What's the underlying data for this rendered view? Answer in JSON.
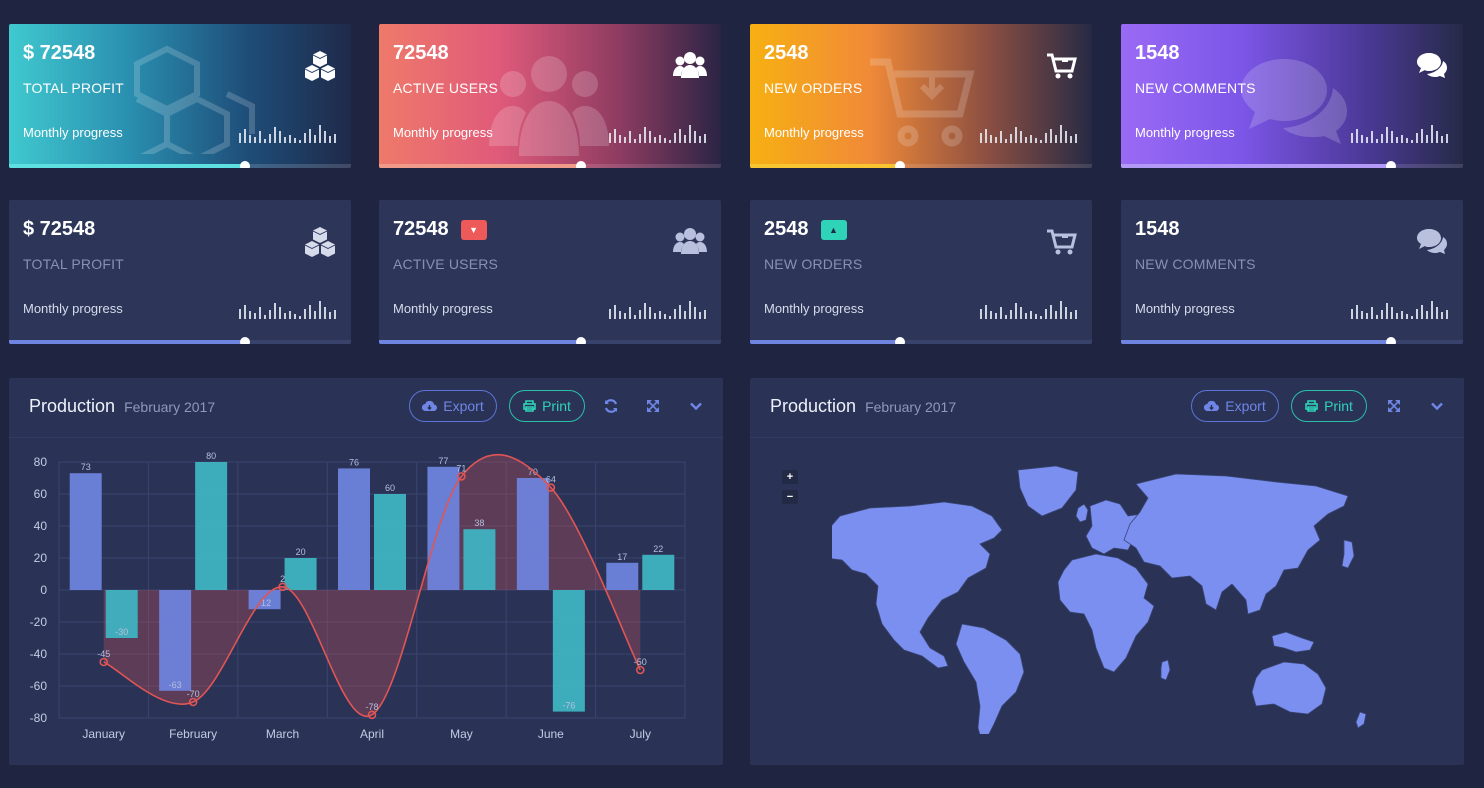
{
  "colors": {
    "page_bg": "#1f2540",
    "flat_card": "#2d3658",
    "panel": "#2a3356",
    "blue_bar": "#6f84e0",
    "teal_bar": "#3fb7c4",
    "red_line": "#e05555",
    "export": "#5b73d6",
    "print": "#2bbfa8"
  },
  "gradient_cards": [
    {
      "value": "$ 72548",
      "label": "TOTAL PROFIT",
      "progress_label": "Monthly progress",
      "icon": "cubes-icon",
      "progress": 0.69
    },
    {
      "value": "72548",
      "label": "ACTIVE USERS",
      "progress_label": "Monthly progress",
      "icon": "users-icon",
      "progress": 0.59
    },
    {
      "value": "2548",
      "label": "NEW ORDERS",
      "progress_label": "Monthly progress",
      "icon": "cart-icon",
      "progress": 0.44
    },
    {
      "value": "1548",
      "label": "NEW COMMENTS",
      "progress_label": "Monthly progress",
      "icon": "comments-icon",
      "progress": 0.79
    }
  ],
  "flat_cards": [
    {
      "value": "$ 72548",
      "label": "TOTAL PROFIT",
      "progress_label": "Monthly progress",
      "icon": "cubes-icon",
      "progress": 0.69
    },
    {
      "value": "72548",
      "label": "ACTIVE USERS",
      "progress_label": "Monthly progress",
      "icon": "users-icon",
      "badge": "down-caret-icon",
      "progress": 0.59
    },
    {
      "value": "2548",
      "label": "NEW ORDERS",
      "progress_label": "Monthly progress",
      "icon": "cart-icon",
      "badge": "up-caret-icon",
      "progress": 0.44
    },
    {
      "value": "1548",
      "label": "NEW COMMENTS",
      "progress_label": "Monthly progress",
      "icon": "comments-icon",
      "progress": 0.79
    }
  ],
  "panels": [
    {
      "title": "Production",
      "subtitle": "February 2017",
      "export_label": "Export",
      "print_label": "Print"
    },
    {
      "title": "Production",
      "subtitle": "February 2017",
      "export_label": "Export",
      "print_label": "Print"
    }
  ],
  "map": {
    "zoom_in": "+",
    "zoom_out": "−"
  },
  "chart_data": {
    "type": "bar",
    "categories": [
      "January",
      "February",
      "March",
      "April",
      "May",
      "June",
      "July"
    ],
    "series": [
      {
        "type": "bar",
        "values": [
          73,
          -63,
          -12,
          76,
          77,
          70,
          17
        ],
        "color": "#6f84e0"
      },
      {
        "type": "bar",
        "values": [
          -30,
          80,
          20,
          60,
          38,
          -76,
          22
        ],
        "color": "#3fb7c4"
      },
      {
        "type": "area",
        "values": [
          -45,
          -70,
          2,
          -78,
          71,
          64,
          -50
        ],
        "color": "#e05555"
      }
    ],
    "ylim": [
      -80,
      80
    ],
    "yticks": [
      80,
      60,
      40,
      20,
      0,
      -20,
      -40,
      -60,
      -80
    ],
    "grid": true
  }
}
